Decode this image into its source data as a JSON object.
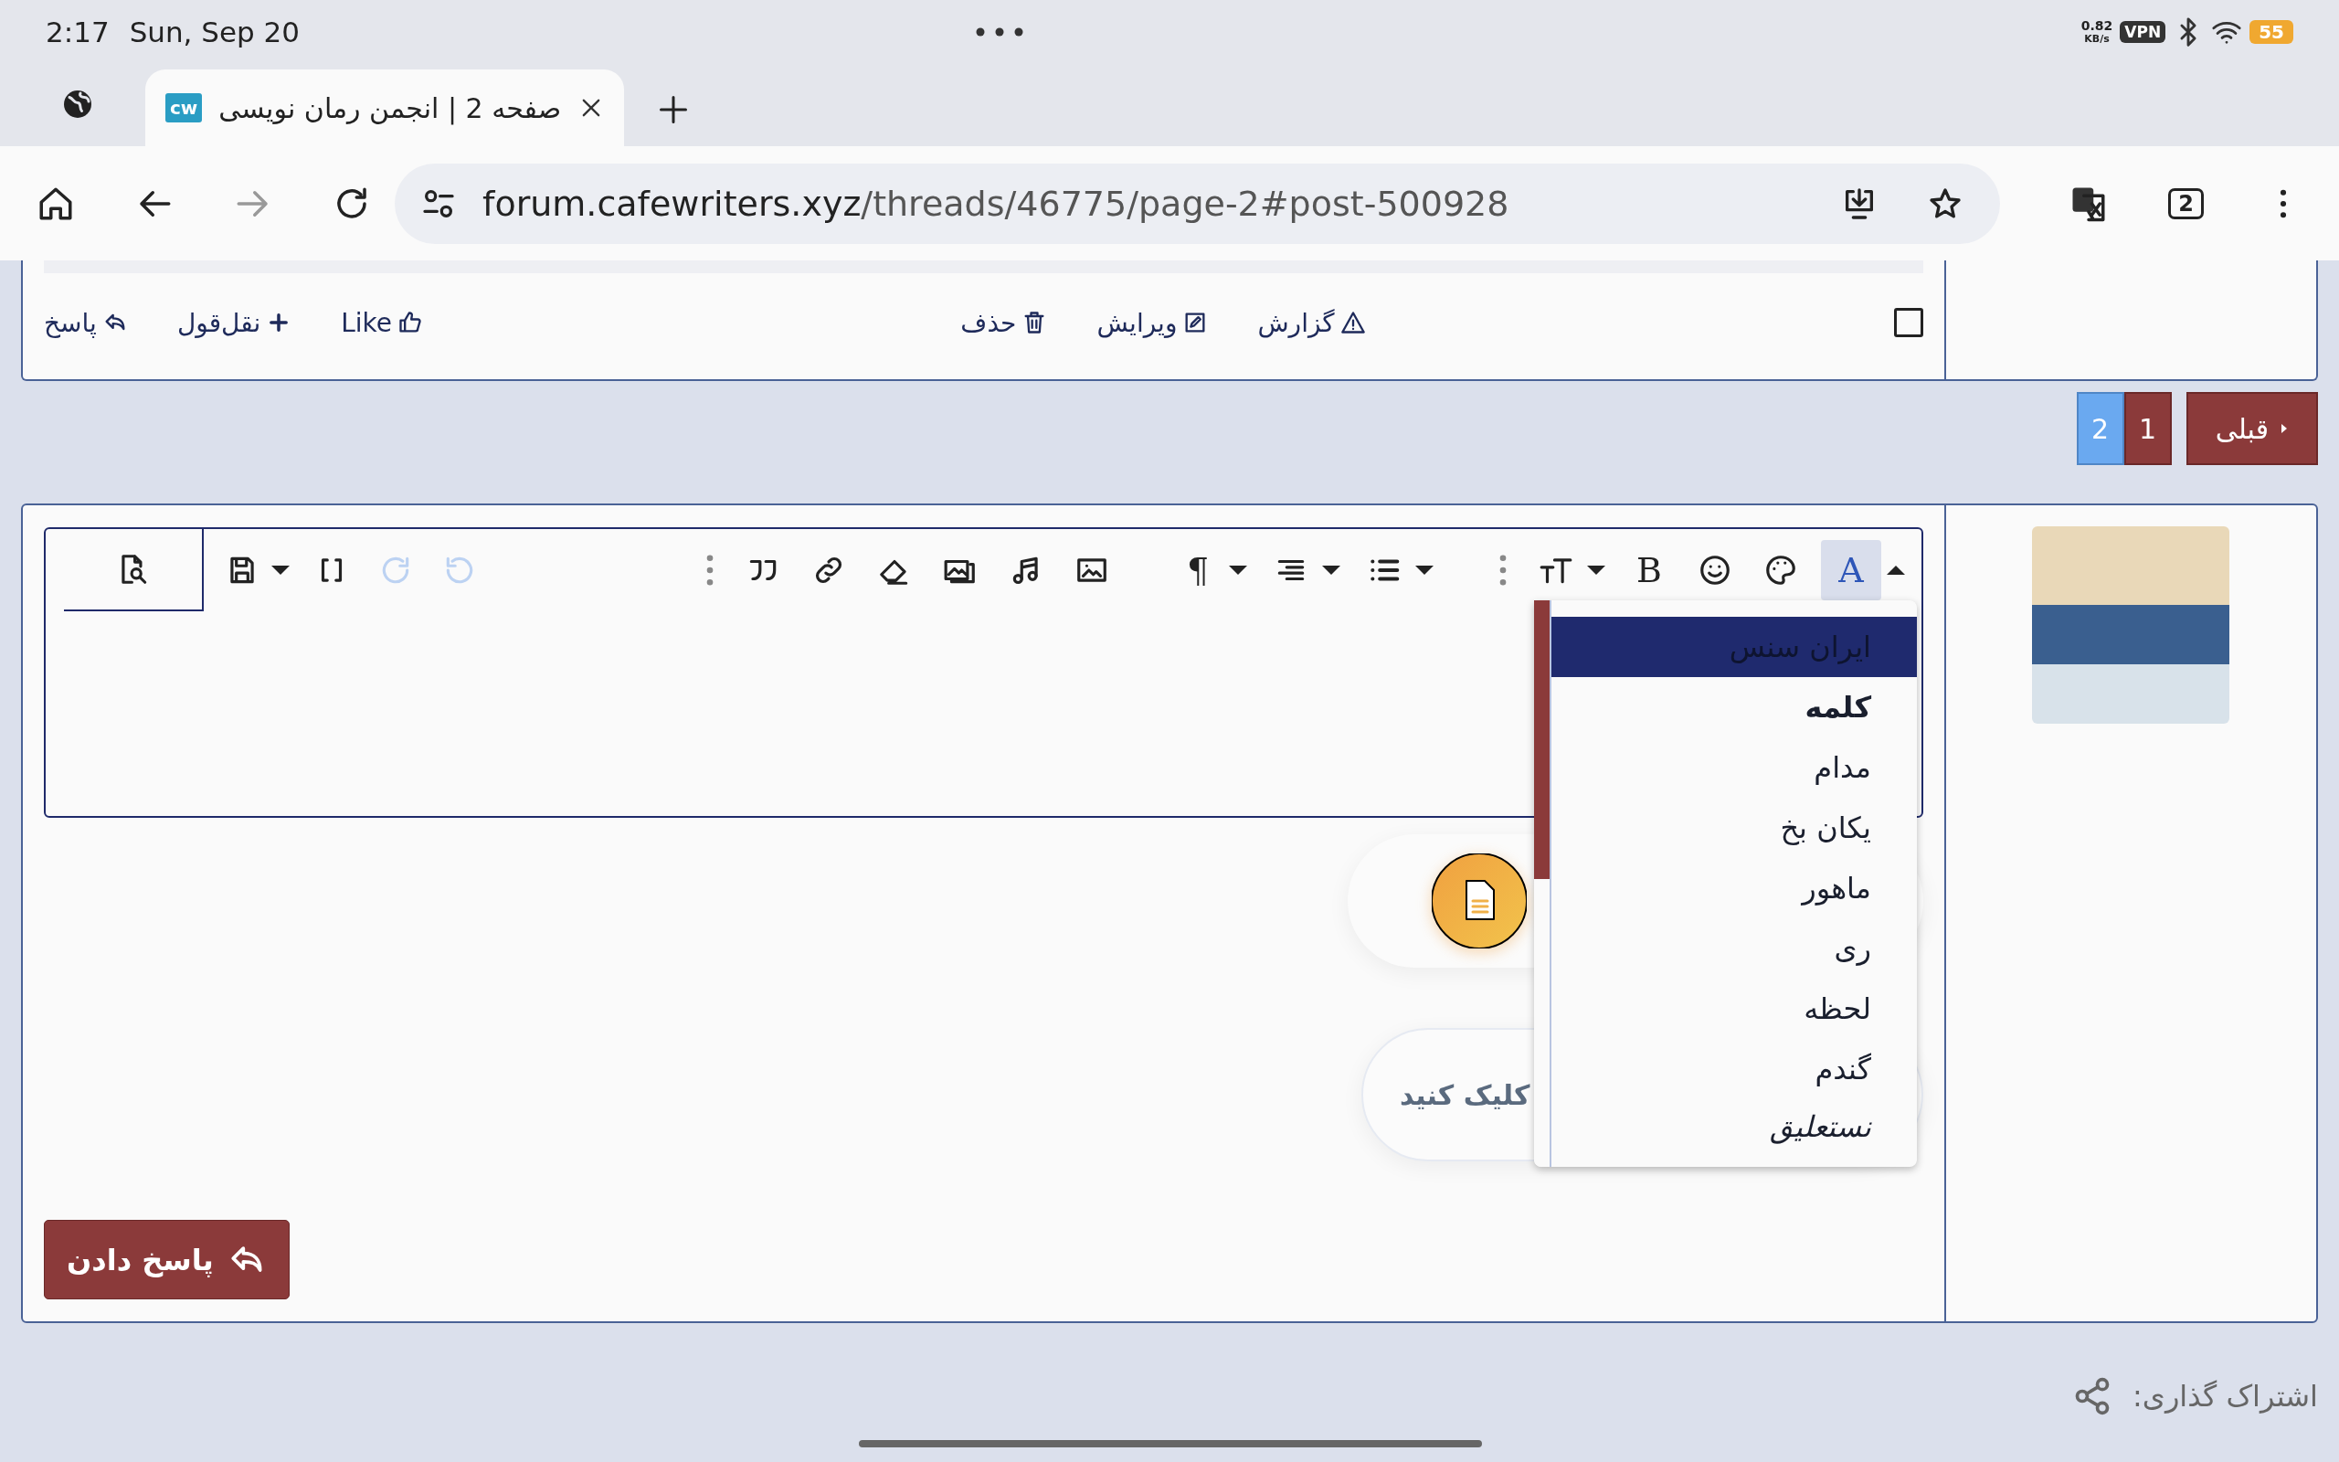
{
  "status_bar": {
    "time": "2:17",
    "date": "Sun, Sep 20",
    "net_speed": "0.82",
    "net_unit": "KB/s",
    "vpn": "VPN",
    "battery": "55"
  },
  "browser": {
    "tab": {
      "favicon": "cw",
      "title": "صفحه 2 | انجمن رمان نویسی"
    },
    "url_host": "forum.cafewriters.xyz",
    "url_path": "/threads/46775/page-2#post-500928",
    "tab_count": "2"
  },
  "post_actions": {
    "select_checked": false,
    "right": [
      {
        "kind": "report",
        "label": "گزارش"
      },
      {
        "kind": "edit",
        "label": "ویرایش"
      },
      {
        "kind": "delete",
        "label": "حذف"
      }
    ],
    "left": [
      {
        "kind": "like",
        "label": "Like"
      },
      {
        "kind": "quote",
        "label": "نقل‌قول"
      },
      {
        "kind": "reply",
        "label": "پاسخ"
      }
    ]
  },
  "pagination": [
    {
      "kind": "prev",
      "label": "قبلی",
      "selected": false
    },
    {
      "kind": "page",
      "label": "1",
      "selected": false
    },
    {
      "kind": "page",
      "label": "2",
      "selected": true
    }
  ],
  "editor": {
    "toolbar": [
      {
        "items": [
          {
            "kind": "caret_up",
            "selected": false,
            "disabled": false
          },
          {
            "kind": "fontcolor",
            "glyph": "A",
            "selected": true,
            "disabled": false
          },
          {
            "kind": "palette",
            "selected": false,
            "disabled": false
          },
          {
            "kind": "smiley",
            "selected": false,
            "disabled": false
          },
          {
            "kind": "bold",
            "glyph": "B",
            "selected": false,
            "disabled": false
          },
          {
            "kind": "caret",
            "selected": false,
            "disabled": false
          },
          {
            "kind": "fontsize",
            "selected": false,
            "disabled": false
          },
          {
            "kind": "dots",
            "selected": false,
            "disabled": false
          }
        ]
      },
      {
        "items": [
          {
            "kind": "caret",
            "selected": false,
            "disabled": false
          },
          {
            "kind": "list",
            "selected": false,
            "disabled": false
          },
          {
            "kind": "caret",
            "selected": false,
            "disabled": false
          },
          {
            "kind": "align",
            "selected": false,
            "disabled": false
          },
          {
            "kind": "caret",
            "selected": false,
            "disabled": false
          },
          {
            "kind": "pilcrow",
            "glyph": "¶",
            "selected": false,
            "disabled": false
          }
        ]
      },
      {
        "items": [
          {
            "kind": "image",
            "selected": false,
            "disabled": false
          },
          {
            "kind": "music",
            "selected": false,
            "disabled": false
          },
          {
            "kind": "gallery",
            "selected": false,
            "disabled": false
          },
          {
            "kind": "eraser",
            "selected": false,
            "disabled": false
          },
          {
            "kind": "link",
            "selected": false,
            "disabled": false
          },
          {
            "kind": "quote",
            "selected": false,
            "disabled": false
          },
          {
            "kind": "dots",
            "selected": false,
            "disabled": false
          }
        ]
      },
      {
        "items": [
          {
            "kind": "undo",
            "selected": false,
            "disabled": true
          },
          {
            "kind": "redo",
            "selected": false,
            "disabled": true
          },
          {
            "kind": "brackets",
            "selected": false,
            "disabled": false
          },
          {
            "kind": "caret",
            "selected": false,
            "disabled": false
          },
          {
            "kind": "save",
            "selected": false,
            "disabled": false
          },
          {
            "kind": "preview",
            "selected": false,
            "disabled": false
          }
        ]
      }
    ],
    "font_menu": [
      {
        "label": "ایران سنس",
        "selected": true
      },
      {
        "label": "کلمه",
        "selected": false
      },
      {
        "label": "مدام",
        "selected": false
      },
      {
        "label": "یکان بخ",
        "selected": false
      },
      {
        "label": "ماهور",
        "selected": false
      },
      {
        "label": "ری",
        "selected": false
      },
      {
        "label": "لحظه",
        "selected": false
      },
      {
        "label": "گندم",
        "selected": false
      },
      {
        "label": "نستعلیق",
        "selected": false
      }
    ],
    "hint": "کلیک کنید"
  },
  "reply_button": "پاسخ دادن",
  "share_label": "اشتراک گذاری:"
}
